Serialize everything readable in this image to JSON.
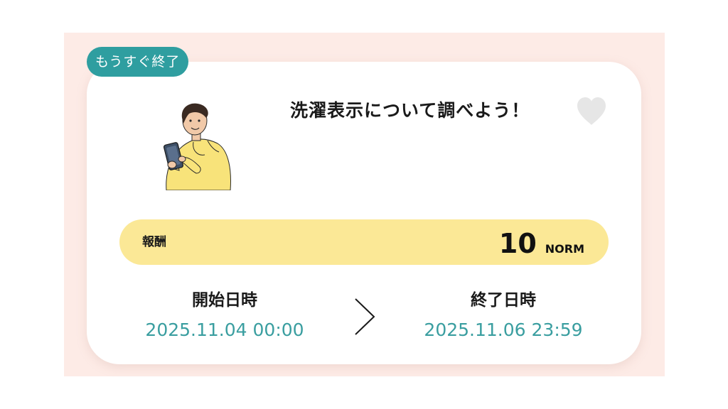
{
  "badge": {
    "label": "もうすぐ終了"
  },
  "task": {
    "title": "洗濯表示について調べよう！",
    "favorite": false
  },
  "reward": {
    "label": "報酬",
    "amount": "10",
    "unit": "NORM"
  },
  "schedule": {
    "start_label": "開始日時",
    "start_value": "2025.11.04 00:00",
    "end_label": "終了日時",
    "end_value": "2025.11.06 23:59"
  },
  "icons": {
    "favorite": "heart-icon",
    "separator": "chevron-right-icon",
    "illustration": "person-with-phone-illustration"
  },
  "colors": {
    "badge": "#2f9ea0",
    "reward_bar": "#fbe896",
    "date_text": "#3a9ea0",
    "background": "#fdebe6"
  }
}
